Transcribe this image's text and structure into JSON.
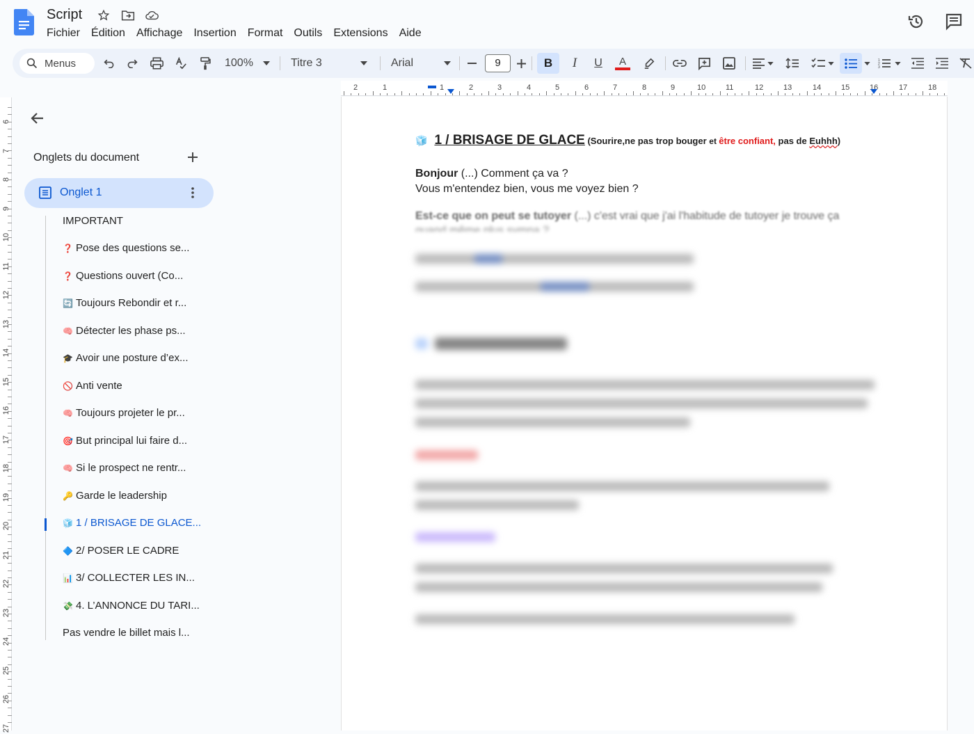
{
  "app": {
    "title": "Script",
    "menus": [
      "Fichier",
      "Édition",
      "Affichage",
      "Insertion",
      "Format",
      "Outils",
      "Extensions",
      "Aide"
    ]
  },
  "toolbar": {
    "search_label": "Menus",
    "zoom": "100%",
    "style": "Titre 3",
    "font": "Arial",
    "font_size": "9",
    "bold_label": "B",
    "italic_label": "I",
    "underline_label": "U",
    "text_color_label": "A"
  },
  "ruler": {
    "top_numbers": [
      "2",
      "1",
      "1",
      "2",
      "3",
      "4",
      "5",
      "6",
      "7",
      "8",
      "9",
      "10",
      "11",
      "12",
      "13",
      "14",
      "15",
      "16",
      "17",
      "18"
    ],
    "left_numbers": [
      "6",
      "7",
      "8",
      "9",
      "10",
      "11",
      "12",
      "13",
      "14",
      "15",
      "16",
      "17",
      "18",
      "19",
      "20",
      "21",
      "22",
      "23",
      "24",
      "25",
      "26",
      "27"
    ]
  },
  "side_panel": {
    "heading": "Onglets du document",
    "tab_label": "Onglet 1",
    "outline": [
      {
        "emoji": "",
        "text": "IMPORTANT"
      },
      {
        "emoji": "❓",
        "text": "Pose des questions se..."
      },
      {
        "emoji": "❓",
        "text": "Questions ouvert (Co..."
      },
      {
        "emoji": "🔄",
        "text": "Toujours Rebondir et r..."
      },
      {
        "emoji": "🧠",
        "text": "Détecter les phase ps..."
      },
      {
        "emoji": "🎓",
        "text": "Avoir une posture d’ex..."
      },
      {
        "emoji": "🚫",
        "text": "Anti vente"
      },
      {
        "emoji": "🧠",
        "text": "Toujours projeter le pr..."
      },
      {
        "emoji": "🎯",
        "text": "But principal lui faire d..."
      },
      {
        "emoji": "🧠",
        "text": "Si le prospect ne rentr..."
      },
      {
        "emoji": "🔑",
        "text": "Garde le leadership"
      },
      {
        "emoji": "🧊",
        "text": "1 / BRISAGE DE GLACE..."
      },
      {
        "emoji": "🔷",
        "text": "2/ POSER LE CADRE"
      },
      {
        "emoji": "📊",
        "text": "3/ COLLECTER LES IN..."
      },
      {
        "emoji": "💸",
        "text": "4. L’ANNONCE DU TARI..."
      },
      {
        "emoji": "",
        "text": "Pas vendre le billet mais l..."
      }
    ]
  },
  "document": {
    "heading_emoji": "🧊",
    "heading_main": "1 / BRISAGE DE GLACE",
    "heading_sub_1": " (Sourire,ne pas trop bouger ",
    "heading_sub_et": "et ",
    "heading_sub_red": "être confiant,",
    "heading_sub_2": " pas de ",
    "heading_sub_euhhh": "Euhhh",
    "heading_sub_close": ")",
    "greeting_bold": "Bonjour",
    "greeting_rest": " (...) Comment ça va ?",
    "line2": "Vous m'entendez bien, vous me voyez bien ?",
    "line3_bold": "Est-ce que on peut se tutoyer",
    "line3_rest": " (...) c'est vrai que j'ai l'habitude de tutoyer je trouve ça",
    "line3_cont": "quand même plus sympa ?"
  }
}
